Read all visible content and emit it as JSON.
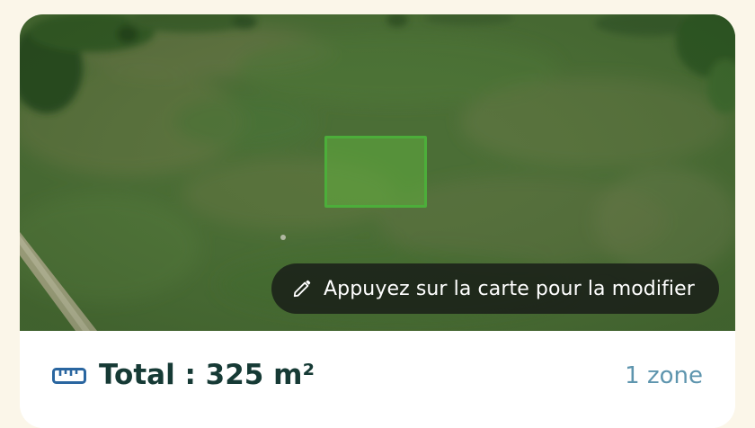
{
  "map": {
    "hint": {
      "text": "Appuyez sur la carte pour la modifier",
      "icon": "pencil-icon"
    },
    "zone_color": "#4cae3a"
  },
  "summary": {
    "icon": "ruler-icon",
    "total_label": "Total : 325 m²",
    "zone_count": "1 zone"
  },
  "colors": {
    "background": "#fbf6e9",
    "total_text": "#163a35",
    "zone_count_text": "#5e95ae",
    "hint_background": "#1a1e18"
  }
}
